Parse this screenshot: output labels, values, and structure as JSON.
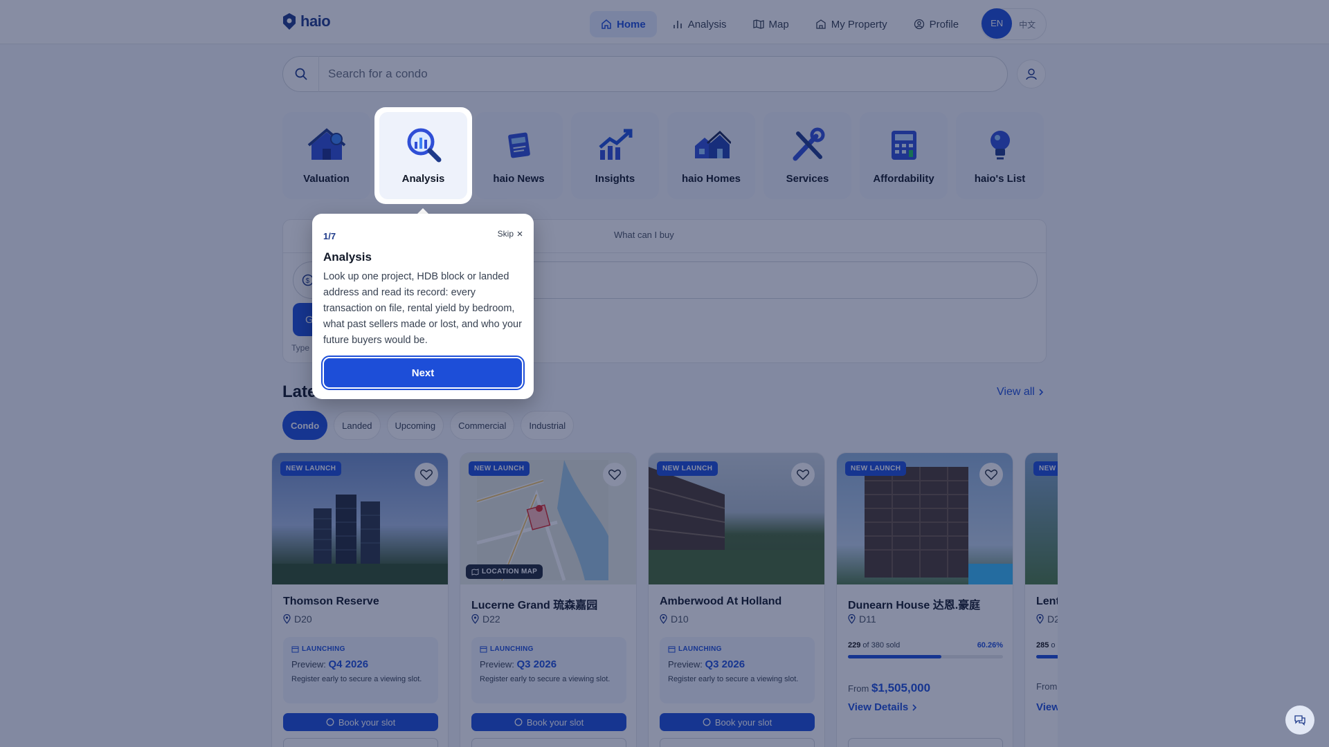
{
  "brand": {
    "name": "haio"
  },
  "nav": {
    "items": [
      {
        "label": "Home",
        "icon": "home-icon",
        "active": true
      },
      {
        "label": "Analysis",
        "icon": "bar-chart-icon"
      },
      {
        "label": "Map",
        "icon": "map-icon"
      },
      {
        "label": "My Property",
        "icon": "building-icon"
      },
      {
        "label": "Profile",
        "icon": "user-circle-icon"
      }
    ],
    "lang_active": "EN",
    "lang_other": "中文"
  },
  "search": {
    "placeholder": "Search for a condo"
  },
  "categories": [
    {
      "label": "Valuation",
      "icon": "house-coin-icon"
    },
    {
      "label": "Analysis",
      "icon": "magnifier-chart-icon"
    },
    {
      "label": "haio News",
      "icon": "newspaper-icon"
    },
    {
      "label": "Insights",
      "icon": "trend-up-icon"
    },
    {
      "label": "haio Homes",
      "icon": "houses-icon"
    },
    {
      "label": "Services",
      "icon": "tools-icon"
    },
    {
      "label": "Affordability",
      "icon": "calculator-icon"
    },
    {
      "label": "haio's List",
      "icon": "lightbulb-icon"
    }
  ],
  "calculator": {
    "tab_label": "What can I buy",
    "button_label": "G",
    "hint": "Type"
  },
  "latest": {
    "title": "Late",
    "view_all": "View all",
    "chips": [
      "Condo",
      "Landed",
      "Upcoming",
      "Commercial",
      "Industrial"
    ],
    "active_chip": "Condo"
  },
  "listings": [
    {
      "name": "Thomson Reserve",
      "district": "D20",
      "badge": "NEW LAUNCH",
      "status": "LAUNCHING",
      "preview_label": "Preview:",
      "preview": "Q4 2026",
      "note": "Register early to secure a viewing slot.",
      "cta": "Book your slot"
    },
    {
      "name": "Lucerne Grand 琉森嘉园",
      "district": "D22",
      "badge": "NEW LAUNCH",
      "overlay": "LOCATION MAP",
      "status": "LAUNCHING",
      "preview_label": "Preview:",
      "preview": "Q3 2026",
      "note": "Register early to secure a viewing slot.",
      "cta": "Book your slot"
    },
    {
      "name": "Amberwood At Holland",
      "district": "D10",
      "badge": "NEW LAUNCH",
      "status": "LAUNCHING",
      "preview_label": "Preview:",
      "preview": "Q3 2026",
      "note": "Register early to secure a viewing slot.",
      "cta": "Book your slot"
    },
    {
      "name": "Dunearn House 达恩.豪庭",
      "district": "D11",
      "badge": "NEW LAUNCH",
      "sold": "229",
      "total_text": "of 380 sold",
      "sold_pct": "60.26%",
      "sold_fraction": 0.6026,
      "price_label": "From",
      "price": "$1,505,000",
      "details": "View Details"
    },
    {
      "name": "Lent",
      "district": "D2",
      "badge": "NEW",
      "sold": "285",
      "total_text": "o",
      "sold_fraction": 0.6,
      "price_label": "From",
      "details": "View"
    }
  ],
  "tour": {
    "step": "1/7",
    "skip": "Skip",
    "title": "Analysis",
    "body": "Look up one project, HDB block or landed address and read its record: every transaction on file, rental yield by bedroom, what past sellers made or lost, and who your future buyers would be.",
    "next": "Next"
  },
  "colors": {
    "primary": "#1d4ed8",
    "brand_dark": "#1e3a8a",
    "overlay": "#101c48"
  }
}
